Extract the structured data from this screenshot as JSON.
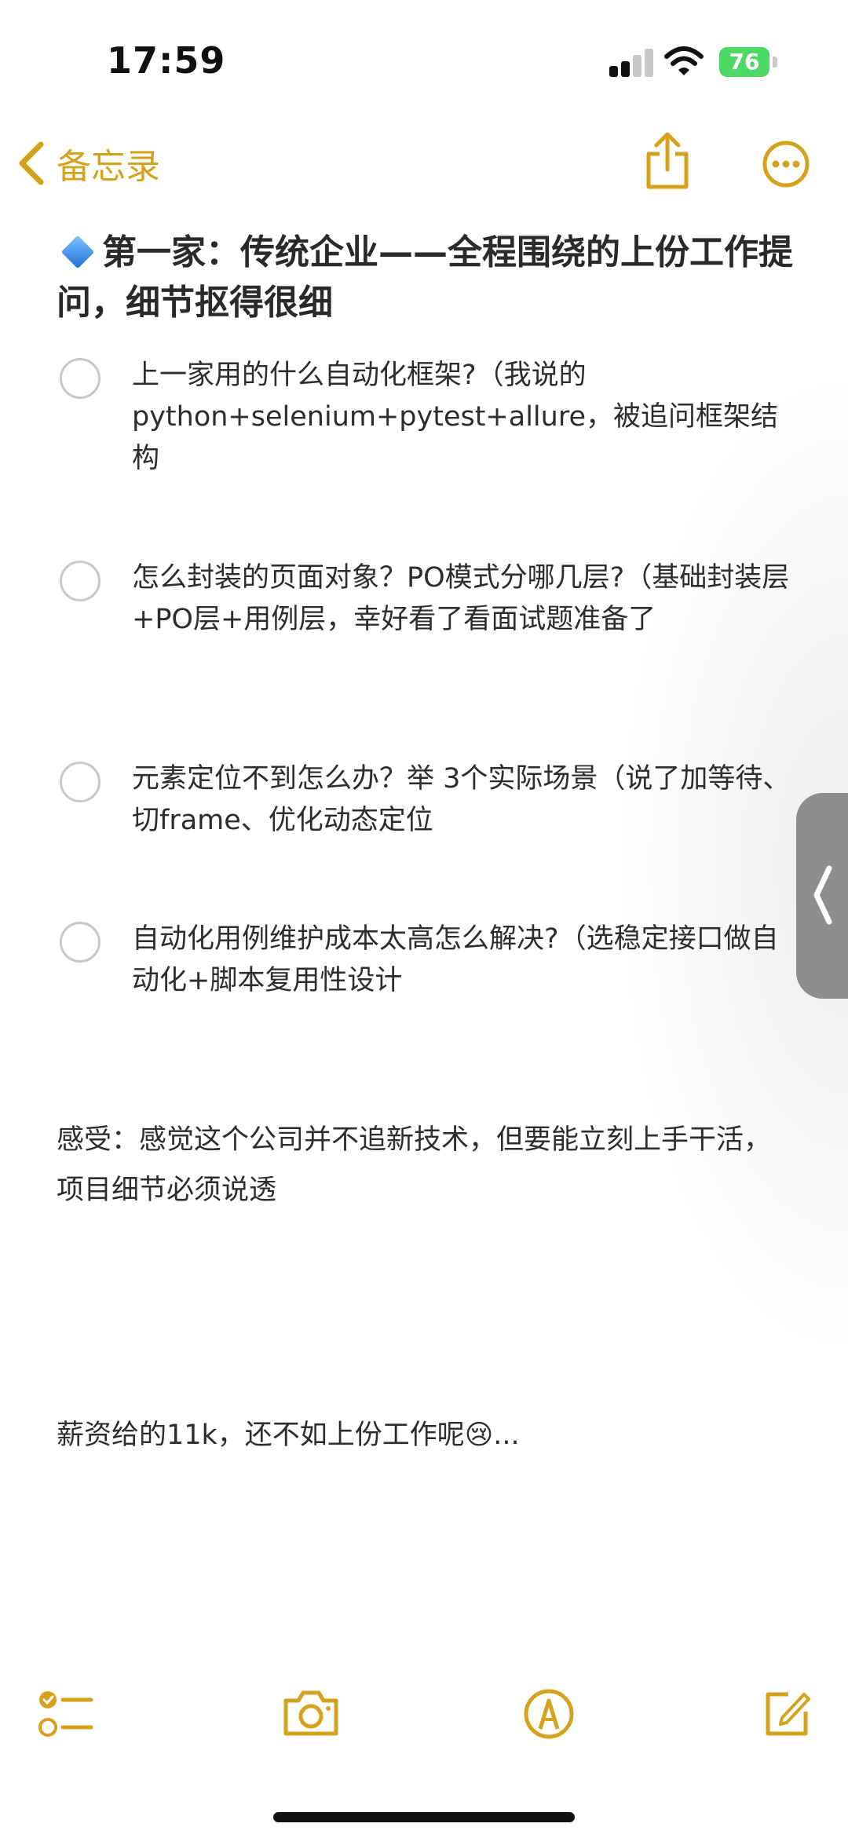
{
  "status": {
    "time": "17:59",
    "battery": "76"
  },
  "nav": {
    "back_label": "备忘录"
  },
  "note": {
    "title": "第一家：传统企业——全程围绕的上份工作提问，细节抠得很细",
    "checklist": [
      {
        "text": "上一家用的什么自动化框架?（我说的python+selenium+pytest+allure，被追问框架结构"
      },
      {
        "text": "怎么封装的页面对象？PO模式分哪几层?（基础封装层+PO层+用例层，幸好看了看面试题准备了"
      },
      {
        "text": "元素定位不到怎么办？举 3个实际场景（说了加等待、切frame、优化动态定位"
      },
      {
        "text": "自动化用例维护成本太高怎么解决?（选稳定接口做自动化+脚本复用性设计"
      }
    ],
    "feeling": "感受：感觉这个公司并不追新技术，但要能立刻上手干活，项目细节必须说透",
    "salary": "薪资给的11k，还不如上份工作呢😢..."
  },
  "colors": {
    "accent": "#d4a21c",
    "battery": "#4cd964"
  },
  "icons": {
    "back": "chevron-left-icon",
    "share": "share-icon",
    "more": "ellipsis-circle-icon",
    "checklist": "checklist-icon",
    "camera": "camera-icon",
    "markup": "pen-circle-icon",
    "compose": "compose-icon"
  }
}
